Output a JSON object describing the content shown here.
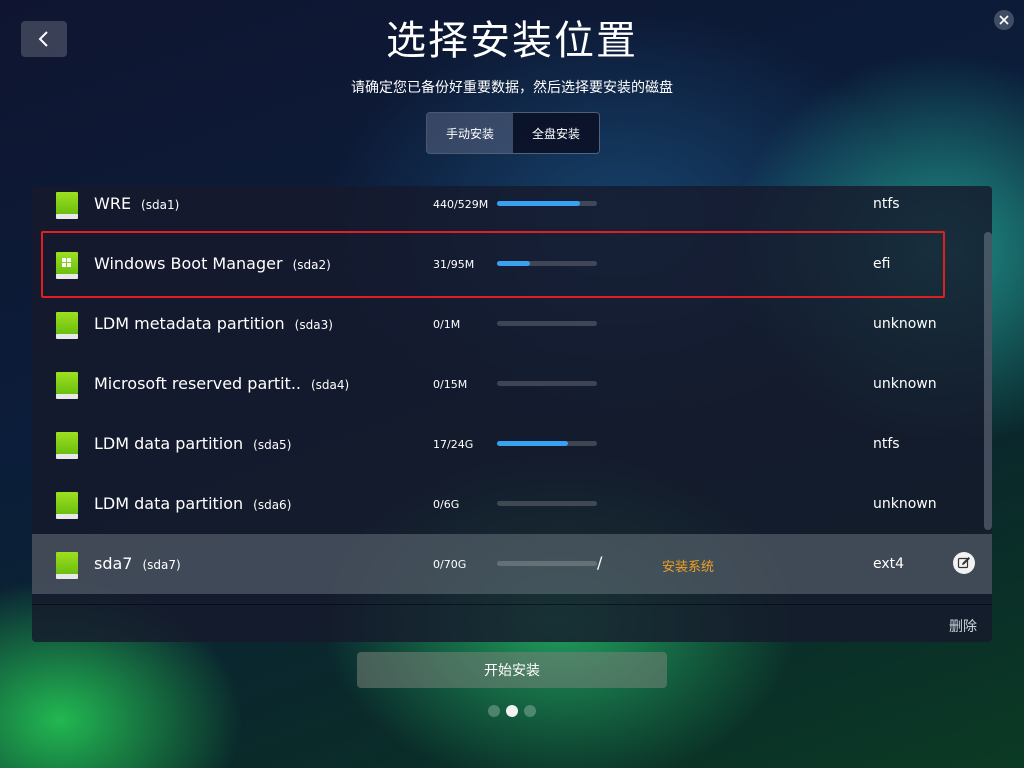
{
  "header": {
    "title": "选择安装位置",
    "subtitle": "请确定您已备份好重要数据，然后选择要安装的磁盘"
  },
  "mode_tabs": [
    {
      "label": "手动安装",
      "active": true
    },
    {
      "label": "全盘安装",
      "active": false
    }
  ],
  "partitions": [
    {
      "name": "WRE",
      "device": "(sda1)",
      "usage": "440/529M",
      "fill": 0.83,
      "fs": "ntfs"
    },
    {
      "name": "Windows Boot Manager",
      "device": "(sda2)",
      "usage": "31/95M",
      "fill": 0.33,
      "fs": "efi",
      "windows_icon": true
    },
    {
      "name": "LDM metadata partition",
      "device": "(sda3)",
      "usage": "0/1M",
      "fill": 0,
      "fs": "unknown"
    },
    {
      "name": "Microsoft reserved partit..",
      "device": "(sda4)",
      "usage": "0/15M",
      "fill": 0,
      "fs": "unknown"
    },
    {
      "name": "LDM data partition",
      "device": "(sda5)",
      "usage": "17/24G",
      "fill": 0.71,
      "fs": "ntfs"
    },
    {
      "name": "LDM data partition",
      "device": "(sda6)",
      "usage": "0/6G",
      "fill": 0,
      "fs": "unknown"
    },
    {
      "name": "sda7",
      "device": "(sda7)",
      "usage": "0/70G",
      "fill": 0,
      "fs": "ext4",
      "mount": "/",
      "label": "安装系统",
      "selected": true
    }
  ],
  "actions": {
    "delete_label": "删除",
    "start_label": "开始安装"
  },
  "pager": {
    "count": 3,
    "active": 1
  },
  "colors": {
    "progress": "#3aa0f0",
    "label_text": "#f0a020",
    "highlight_border": "#e02020"
  }
}
